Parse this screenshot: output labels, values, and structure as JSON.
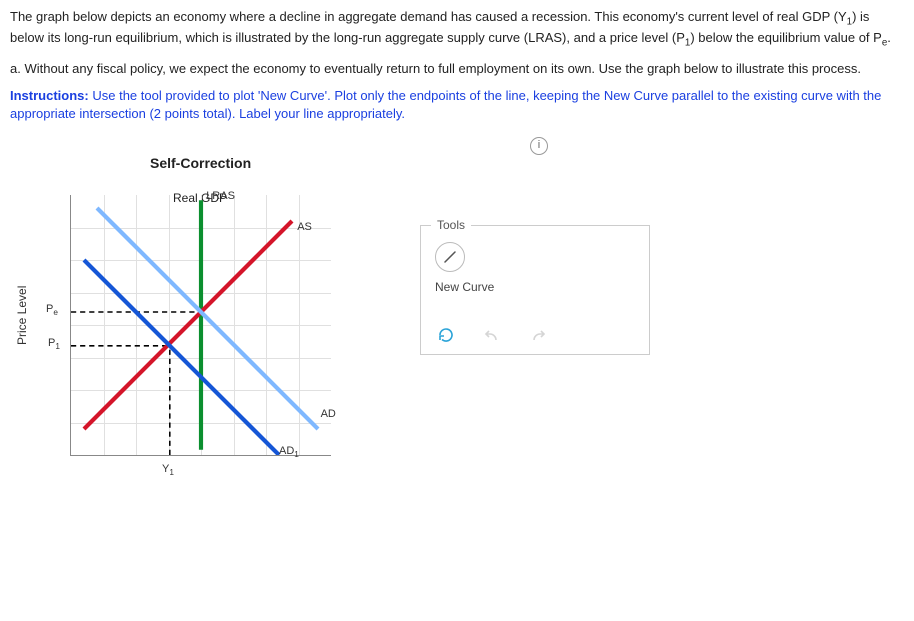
{
  "intro_p1a": "The graph below depicts an economy where a decline in aggregate demand has caused a recession. This economy's current level of real GDP (Y",
  "intro_y1_sub": "1",
  "intro_p1b": ") is below its long-run equilibrium, which is illustrated by the long-run aggregate supply curve (LRAS), and a price level (P",
  "intro_p1_sub": "1",
  "intro_p1c": ") below the equilibrium value of P",
  "intro_pe_sub": "e",
  "intro_p1d": ".",
  "question_a": "a. Without any fiscal policy, we expect the economy to eventually return to full employment on its own. Use the graph below to illustrate this process.",
  "instructions_label": "Instructions:",
  "instructions_text": " Use the tool provided to plot 'New Curve'. Plot only the endpoints of the line, keeping the New Curve parallel to the existing curve with the appropriate intersection (2 points total). Label your line appropriately.",
  "info_icon": "i",
  "chart": {
    "title": "Self-Correction",
    "ylabel": "Price Level",
    "xlabel": "Real GDP",
    "lras_label": "LRAS",
    "as_label": "AS",
    "ad_label": "AD",
    "ad1_label_a": "AD",
    "ad1_label_sub": "1",
    "pe_label_a": "P",
    "pe_label_sub": "e",
    "p1_label_a": "P",
    "p1_label_sub": "1",
    "y1_label_a": "Y",
    "y1_label_sub": "1"
  },
  "tools": {
    "legend": "Tools",
    "newcurve": "New Curve"
  },
  "chart_data": {
    "type": "line",
    "note": "Coordinates are in plot-box percentages (0–100 on each axis, y measured upward). Values are visual estimates.",
    "LRAS": {
      "x": 50,
      "y_range": [
        2,
        98
      ]
    },
    "AS": {
      "endpoints": [
        [
          5,
          10
        ],
        [
          85,
          90
        ]
      ]
    },
    "AD": {
      "endpoints": [
        [
          10,
          95
        ],
        [
          95,
          10
        ]
      ]
    },
    "AD1": {
      "endpoints": [
        [
          5,
          75
        ],
        [
          80,
          0
        ]
      ]
    },
    "Pe_guide": {
      "y": 55,
      "x_range": [
        0,
        50
      ]
    },
    "P1_guide": {
      "y": 42,
      "x_range": [
        0,
        38
      ]
    },
    "Y1_guide": {
      "x": 38,
      "y_range": [
        0,
        42
      ]
    },
    "ticks": {
      "Pe": 55,
      "P1": 42,
      "Y1": 38
    }
  }
}
